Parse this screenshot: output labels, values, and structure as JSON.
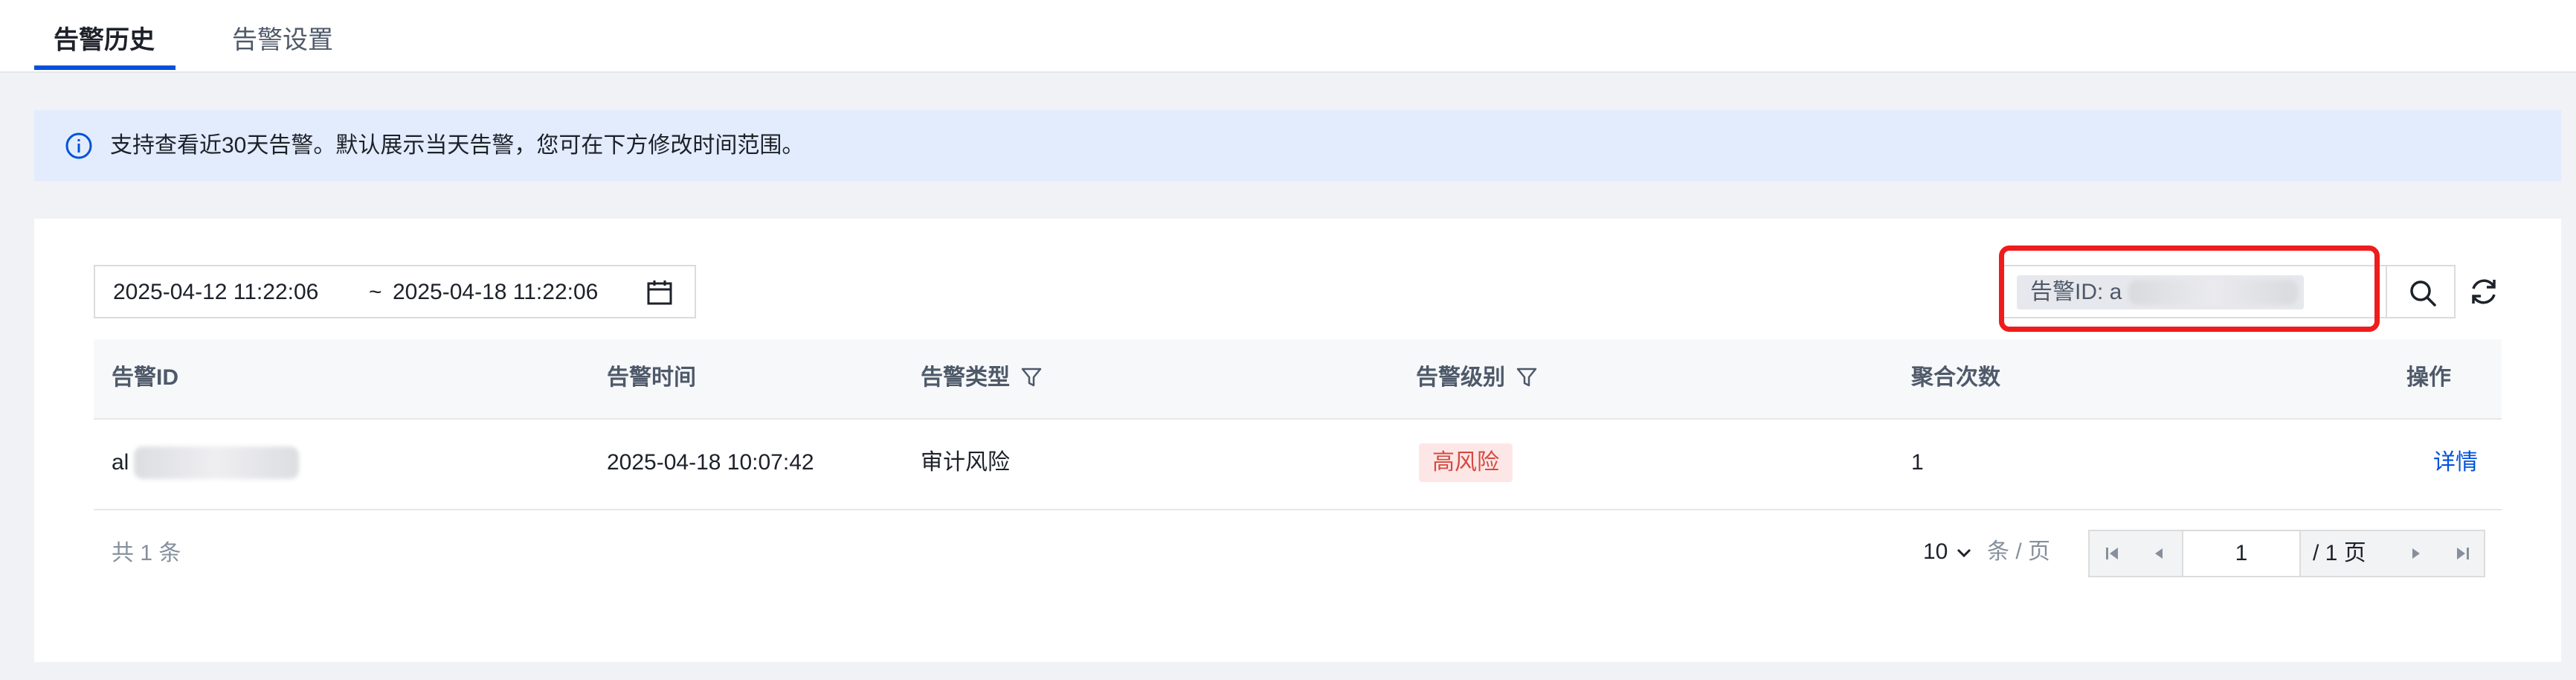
{
  "tabs": [
    {
      "label": "告警历史",
      "active": true
    },
    {
      "label": "告警设置",
      "active": false
    }
  ],
  "notice": {
    "text": "支持查看近30天告警。默认展示当天告警，您可在下方修改时间范围。",
    "icon": "info-circle-icon"
  },
  "filters": {
    "date_start": "2025-04-12 11:22:06",
    "date_separator": "~",
    "date_end": "2025-04-18 11:22:06",
    "search_tag_label": "告警ID: a"
  },
  "table": {
    "columns": [
      "告警ID",
      "告警时间",
      "告警类型",
      "告警级别",
      "聚合次数",
      "操作"
    ],
    "rows": [
      {
        "id": "al",
        "time": "2025-04-18 10:07:42",
        "type": "审计风险",
        "level": "高风险",
        "count": "1",
        "action": "详情"
      }
    ]
  },
  "pagination": {
    "total": "共 1 条",
    "page_size": "10",
    "page_size_unit": "条 / 页",
    "current_page": "1",
    "total_pages": "/ 1 页"
  },
  "colors": {
    "accent": "#0052d9",
    "risk_text": "#d54941",
    "risk_bg": "#fde7e6",
    "notice_bg": "#e3ecfd",
    "highlight": "#ee1c1c"
  }
}
